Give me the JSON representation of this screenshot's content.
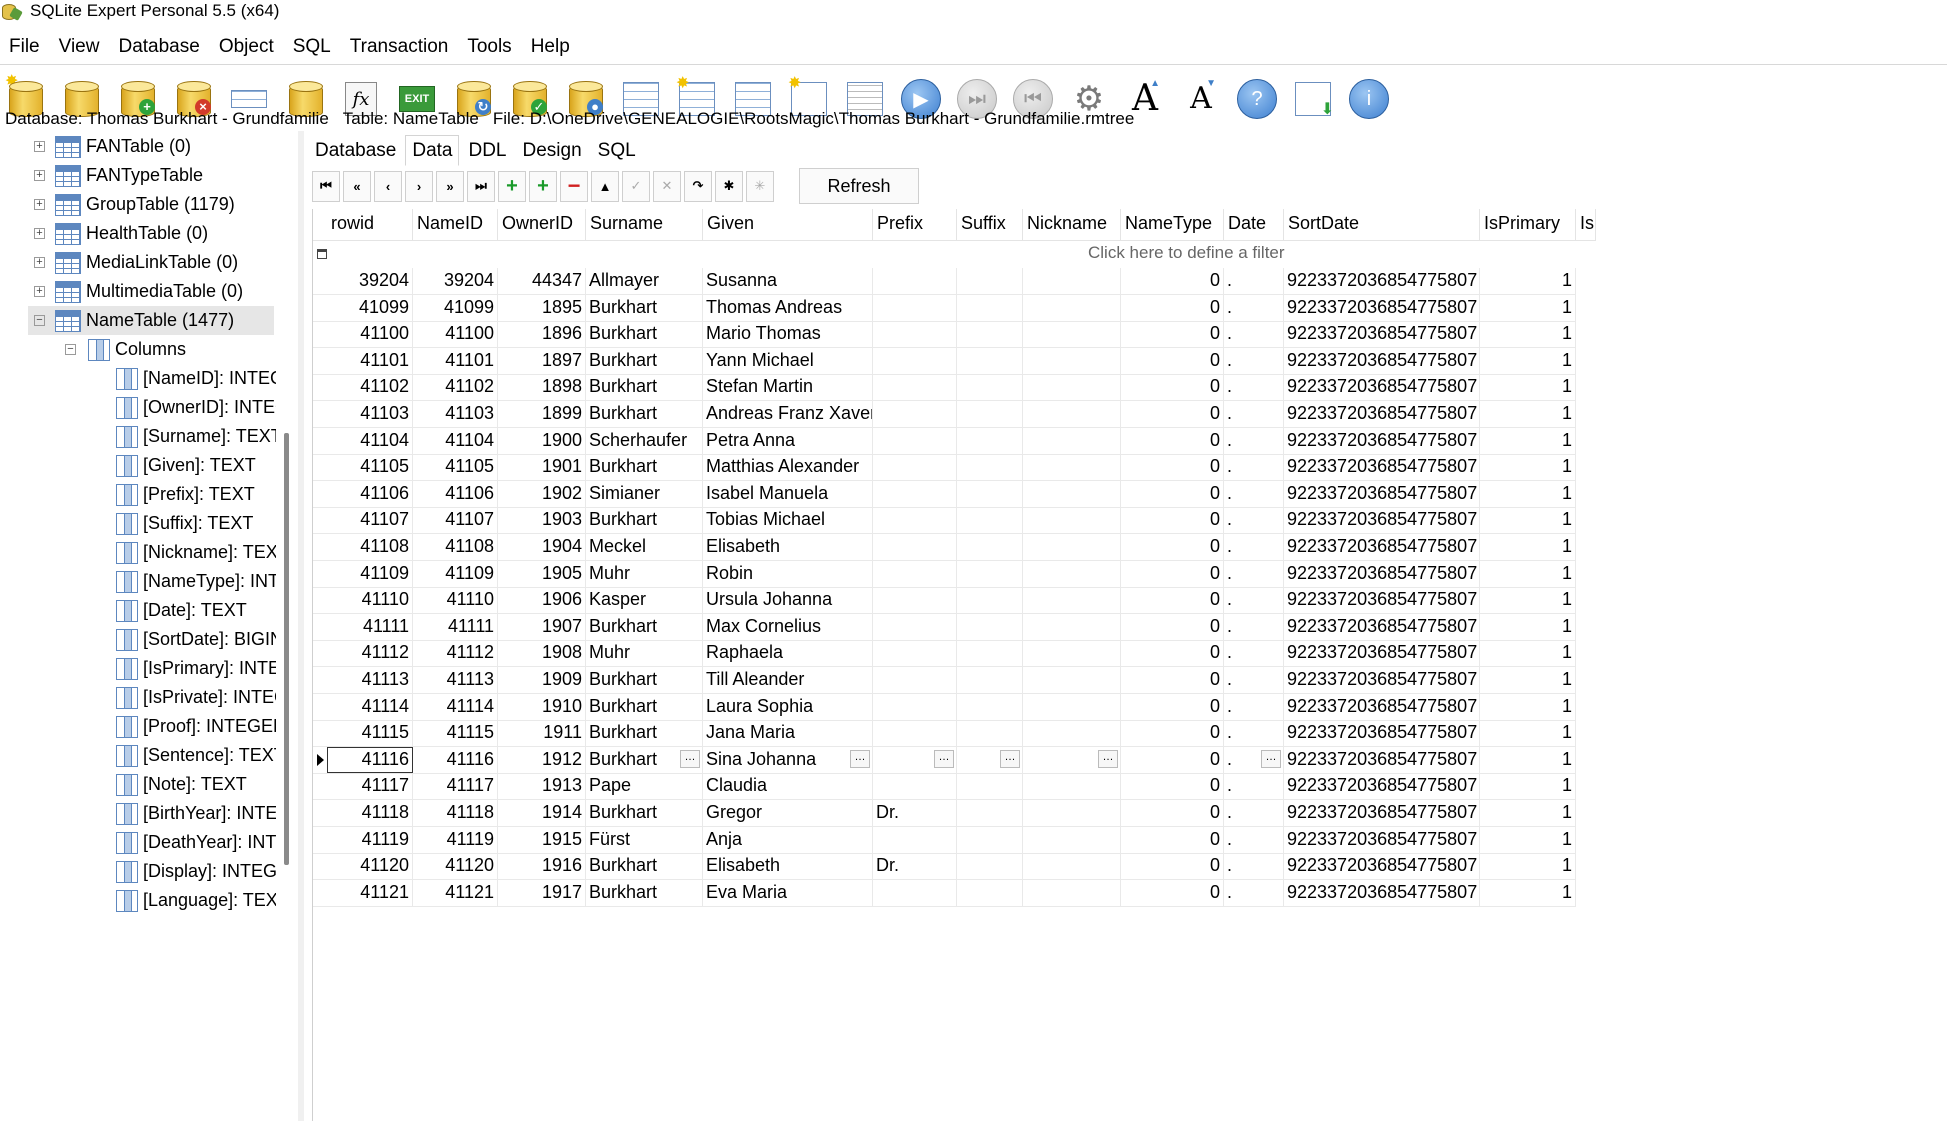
{
  "window": {
    "title": "SQLite Expert Personal 5.5 (x64)"
  },
  "menu": [
    "File",
    "View",
    "Database",
    "Object",
    "SQL",
    "Transaction",
    "Tools",
    "Help"
  ],
  "toolbar": {
    "exit_label": "EXIT",
    "fx_label": "fx",
    "font_label": "A",
    "help_label": "?",
    "info_label": "i"
  },
  "info": {
    "database": "Database: Thomas Burkhart - Grundfamilie",
    "table": "Table: NameTable",
    "file": "File: D:\\OneDrive\\GENEALOGIE\\RootsMagic\\Thomas Burkhart - Grundfamilie.rmtree"
  },
  "tree": {
    "tables": [
      {
        "label": "FANTable (0)",
        "expanded": false
      },
      {
        "label": "FANTypeTable",
        "expanded": false
      },
      {
        "label": "GroupTable (1179)",
        "expanded": false
      },
      {
        "label": "HealthTable (0)",
        "expanded": false
      },
      {
        "label": "MediaLinkTable (0)",
        "expanded": false
      },
      {
        "label": "MultimediaTable (0)",
        "expanded": false
      },
      {
        "label": "NameTable (1477)",
        "expanded": true
      }
    ],
    "columns_label": "Columns",
    "columns": [
      "[NameID]: INTEGER",
      "[OwnerID]: INTEGER",
      "[Surname]: TEXT",
      "[Given]: TEXT",
      "[Prefix]: TEXT",
      "[Suffix]: TEXT",
      "[Nickname]: TEXT",
      "[NameType]: INTEGER",
      "[Date]: TEXT",
      "[SortDate]: BIGINT",
      "[IsPrimary]: INTEGER",
      "[IsPrivate]: INTEGER",
      "[Proof]: INTEGER",
      "[Sentence]: TEXT",
      "[Note]: TEXT",
      "[BirthYear]: INTEGER",
      "[DeathYear]: INTEGER",
      "[Display]: INTEGER",
      "[Language]: TEXT"
    ]
  },
  "tabs": [
    {
      "label": "Database",
      "active": false
    },
    {
      "label": "Data",
      "active": true
    },
    {
      "label": "DDL",
      "active": false
    },
    {
      "label": "Design",
      "active": false
    },
    {
      "label": "SQL",
      "active": false
    }
  ],
  "nav": {
    "refresh_label": "Refresh"
  },
  "grid": {
    "columns": [
      "rowid",
      "NameID",
      "OwnerID",
      "Surname",
      "Given",
      "Prefix",
      "Suffix",
      "Nickname",
      "NameType",
      "Date",
      "SortDate",
      "IsPrimary",
      "Is"
    ],
    "filter_text": "Click here to define a filter",
    "current_row": 18,
    "rows": [
      [
        "39204",
        "39204",
        "44347",
        "Allmayer",
        "Susanna",
        "",
        "",
        "",
        "0",
        ".",
        "9223372036854775807",
        "1"
      ],
      [
        "41099",
        "41099",
        "1895",
        "Burkhart",
        "Thomas Andreas",
        "",
        "",
        "",
        "0",
        ".",
        "9223372036854775807",
        "1"
      ],
      [
        "41100",
        "41100",
        "1896",
        "Burkhart",
        "Mario Thomas",
        "",
        "",
        "",
        "0",
        ".",
        "9223372036854775807",
        "1"
      ],
      [
        "41101",
        "41101",
        "1897",
        "Burkhart",
        "Yann Michael",
        "",
        "",
        "",
        "0",
        ".",
        "9223372036854775807",
        "1"
      ],
      [
        "41102",
        "41102",
        "1898",
        "Burkhart",
        "Stefan Martin",
        "",
        "",
        "",
        "0",
        ".",
        "9223372036854775807",
        "1"
      ],
      [
        "41103",
        "41103",
        "1899",
        "Burkhart",
        "Andreas Franz Xaver",
        "",
        "",
        "",
        "0",
        ".",
        "9223372036854775807",
        "1"
      ],
      [
        "41104",
        "41104",
        "1900",
        "Scherhaufer",
        "Petra Anna",
        "",
        "",
        "",
        "0",
        ".",
        "9223372036854775807",
        "1"
      ],
      [
        "41105",
        "41105",
        "1901",
        "Burkhart",
        "Matthias Alexander",
        "",
        "",
        "",
        "0",
        ".",
        "9223372036854775807",
        "1"
      ],
      [
        "41106",
        "41106",
        "1902",
        "Simianer",
        "Isabel Manuela",
        "",
        "",
        "",
        "0",
        ".",
        "9223372036854775807",
        "1"
      ],
      [
        "41107",
        "41107",
        "1903",
        "Burkhart",
        "Tobias Michael",
        "",
        "",
        "",
        "0",
        ".",
        "9223372036854775807",
        "1"
      ],
      [
        "41108",
        "41108",
        "1904",
        "Meckel",
        "Elisabeth",
        "",
        "",
        "",
        "0",
        ".",
        "9223372036854775807",
        "1"
      ],
      [
        "41109",
        "41109",
        "1905",
        "Muhr",
        "Robin",
        "",
        "",
        "",
        "0",
        ".",
        "9223372036854775807",
        "1"
      ],
      [
        "41110",
        "41110",
        "1906",
        "Kasper",
        "Ursula Johanna",
        "",
        "",
        "",
        "0",
        ".",
        "9223372036854775807",
        "1"
      ],
      [
        "41111",
        "41111",
        "1907",
        "Burkhart",
        "Max Cornelius",
        "",
        "",
        "",
        "0",
        ".",
        "9223372036854775807",
        "1"
      ],
      [
        "41112",
        "41112",
        "1908",
        "Muhr",
        "Raphaela",
        "",
        "",
        "",
        "0",
        ".",
        "9223372036854775807",
        "1"
      ],
      [
        "41113",
        "41113",
        "1909",
        "Burkhart",
        "Till Aleander",
        "",
        "",
        "",
        "0",
        ".",
        "9223372036854775807",
        "1"
      ],
      [
        "41114",
        "41114",
        "1910",
        "Burkhart",
        "Laura Sophia",
        "",
        "",
        "",
        "0",
        ".",
        "9223372036854775807",
        "1"
      ],
      [
        "41115",
        "41115",
        "1911",
        "Burkhart",
        "Jana Maria",
        "",
        "",
        "",
        "0",
        ".",
        "9223372036854775807",
        "1"
      ],
      [
        "41116",
        "41116",
        "1912",
        "Burkhart",
        "Sina Johanna",
        "",
        "",
        "",
        "0",
        ".",
        "9223372036854775807",
        "1"
      ],
      [
        "41117",
        "41117",
        "1913",
        "Pape",
        "Claudia",
        "",
        "",
        "",
        "0",
        ".",
        "9223372036854775807",
        "1"
      ],
      [
        "41118",
        "41118",
        "1914",
        "Burkhart",
        "Gregor",
        "Dr.",
        "",
        "",
        "0",
        ".",
        "9223372036854775807",
        "1"
      ],
      [
        "41119",
        "41119",
        "1915",
        "Fürst",
        "Anja",
        "",
        "",
        "",
        "0",
        ".",
        "9223372036854775807",
        "1"
      ],
      [
        "41120",
        "41120",
        "1916",
        "Burkhart",
        "Elisabeth",
        "Dr.",
        "",
        "",
        "0",
        ".",
        "9223372036854775807",
        "1"
      ],
      [
        "41121",
        "41121",
        "1917",
        "Burkhart",
        "Eva Maria",
        "",
        "",
        "",
        "0",
        ".",
        "9223372036854775807",
        "1"
      ]
    ]
  }
}
